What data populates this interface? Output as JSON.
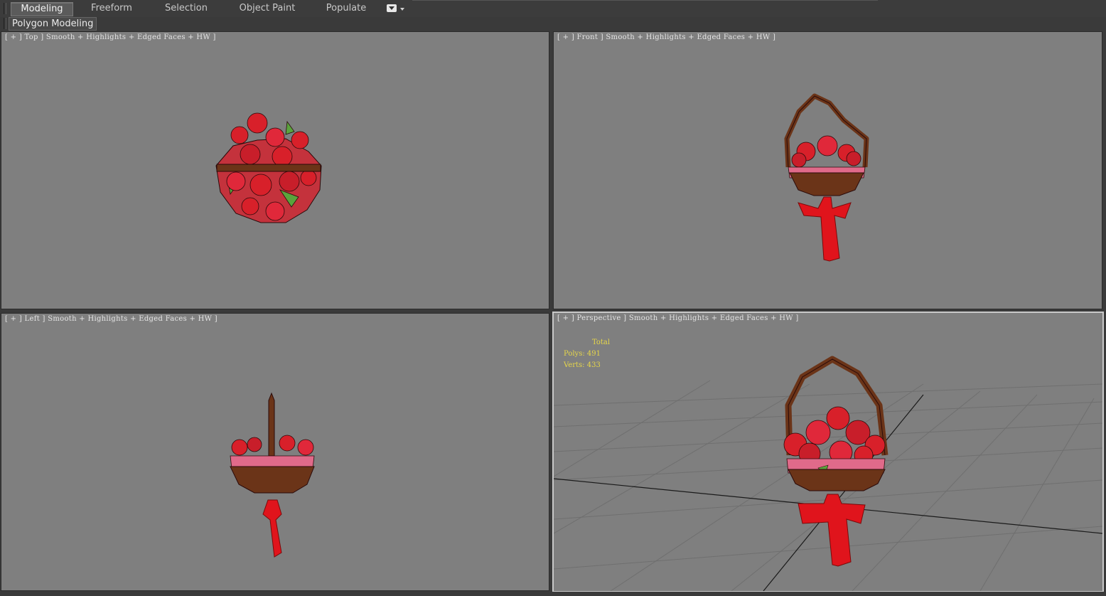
{
  "ribbon": {
    "tabs": [
      {
        "label": "Modeling"
      },
      {
        "label": "Freeform"
      },
      {
        "label": "Selection"
      },
      {
        "label": "Object Paint"
      },
      {
        "label": "Populate"
      }
    ],
    "active_tab": "Modeling",
    "panel_label": "Polygon Modeling"
  },
  "viewports": {
    "top": {
      "view": "Top",
      "shading": "Smooth + Highlights + Edged Faces + HW"
    },
    "front": {
      "view": "Front",
      "shading": "Smooth + Highlights + Edged Faces + HW"
    },
    "left": {
      "view": "Left",
      "shading": "Smooth + Highlights + Edged Faces + HW"
    },
    "perspective": {
      "view": "Perspective",
      "shading": "Smooth + Highlights + Edged Faces + HW",
      "stats": {
        "title": "Total",
        "polys_label": "Polys:",
        "polys": "491",
        "verts_label": "Verts:",
        "verts": "433"
      }
    }
  },
  "colors": {
    "viewport_bg": "#7f7f7f",
    "stats_text": "#e6d64a",
    "basket_wood": "#6b3418",
    "flower_red": "#d8202a",
    "ribbon_red": "#e0141c",
    "leaf_green": "#5aa33c"
  }
}
